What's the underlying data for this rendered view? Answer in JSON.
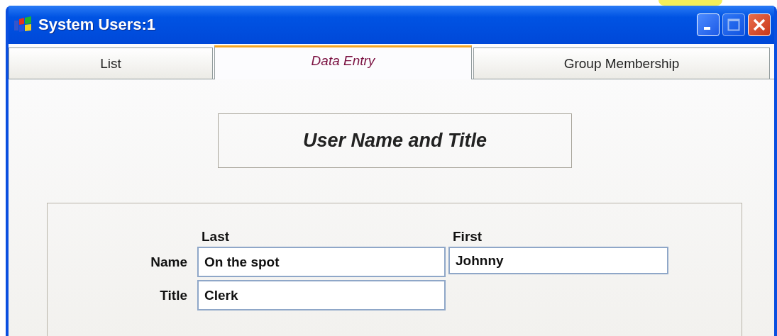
{
  "window": {
    "title": "System Users:1"
  },
  "tabs": [
    {
      "label": "List",
      "selected": false
    },
    {
      "label": "Data Entry",
      "selected": true
    },
    {
      "label": "Group Membership",
      "selected": false
    }
  ],
  "header": "User Name and Title",
  "form": {
    "column_labels": [
      "Last",
      "First"
    ],
    "rows": [
      {
        "label": "Name",
        "fields": [
          "On the spot",
          "Johnny"
        ]
      },
      {
        "label": "Title",
        "fields": [
          "Clerk"
        ]
      }
    ]
  }
}
